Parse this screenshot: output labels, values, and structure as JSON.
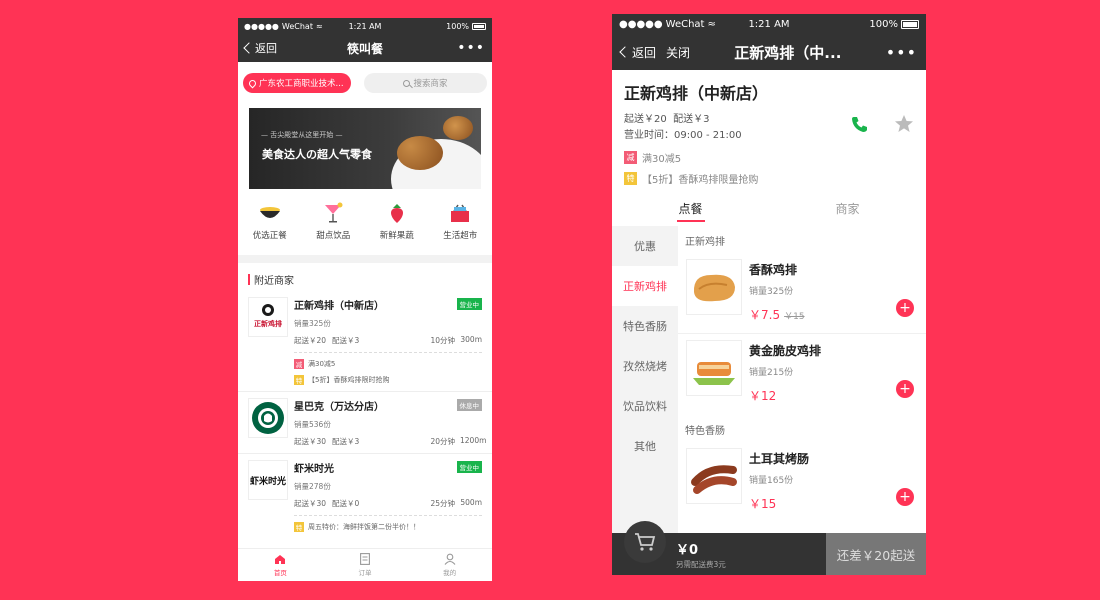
{
  "phoneA": {
    "status": {
      "carrier": "WeChat",
      "time": "1:21 AM",
      "battery": "100%"
    },
    "nav": {
      "back": "返回",
      "title": "筷叫餐",
      "more": "•••"
    },
    "location": "广东农工商职业技术...",
    "search_placeholder": "搜索商家",
    "banner": {
      "subtitle": "— 舌尖殿堂从这里开始 —",
      "title": "美食达人の超人气零食"
    },
    "categories": [
      {
        "label": "优选正餐",
        "icon": "bowl-icon"
      },
      {
        "label": "甜点饮品",
        "icon": "cocktail-icon"
      },
      {
        "label": "新鲜果蔬",
        "icon": "strawberry-icon"
      },
      {
        "label": "生活超市",
        "icon": "basket-icon"
      }
    ],
    "section_title": "附近商家",
    "shops": [
      {
        "name": "正新鸡排（中新店）",
        "sales": "销量325份",
        "min": "起送￥20",
        "delivery": "配送￥3",
        "time": "10分钟",
        "distance": "300m",
        "status": "营业中",
        "promos": [
          {
            "tag": "减",
            "text": "满30减5"
          },
          {
            "tag": "特",
            "text": "【5折】香酥鸡排限时抢购"
          }
        ]
      },
      {
        "name": "星巴克（万达分店）",
        "sales": "销量536份",
        "min": "起送￥30",
        "delivery": "配送￥3",
        "time": "20分钟",
        "distance": "1200m",
        "status": "休息中",
        "promos": []
      },
      {
        "name": "虾米时光",
        "sales": "销量278份",
        "min": "起送￥30",
        "delivery": "配送￥0",
        "time": "25分钟",
        "distance": "500m",
        "status": "营业中",
        "promos": [
          {
            "tag": "特",
            "text": "周五特价：海鲜拌饭第二份半价！！"
          }
        ]
      }
    ],
    "tabs": [
      "首页",
      "订单",
      "我的"
    ],
    "logo_text": {
      "zhengxin": "正新鸡排",
      "xiami": "虾米时光"
    }
  },
  "phoneB": {
    "status": {
      "carrier": "WeChat",
      "time": "1:21 AM",
      "battery": "100%"
    },
    "nav": {
      "back": "返回",
      "close": "关闭",
      "title": "正新鸡排（中...",
      "more": "•••"
    },
    "store": {
      "name": "正新鸡排（中新店）",
      "min": "起送￥20",
      "delivery": "配送￥3",
      "hours": "营业时间：09:00 - 21:00"
    },
    "promos": [
      {
        "tag": "减",
        "text": "满30减5"
      },
      {
        "tag": "特",
        "text": "【5折】香酥鸡排限量抢购"
      }
    ],
    "tabs": [
      "点餐",
      "商家"
    ],
    "left_menu": [
      "优惠",
      "正新鸡排",
      "特色香肠",
      "孜然烧烤",
      "饮品饮料",
      "其他"
    ],
    "groups": [
      {
        "title": "正新鸡排",
        "items": [
          {
            "name": "香酥鸡排",
            "sales": "销量325份",
            "price": "￥7.5",
            "old_price": "￥15"
          },
          {
            "name": "黄金脆皮鸡排",
            "sales": "销量215份",
            "price": "￥12",
            "old_price": ""
          }
        ]
      },
      {
        "title": "特色香肠",
        "items": [
          {
            "name": "土耳其烤肠",
            "sales": "销量165份",
            "price": "￥15",
            "old_price": ""
          }
        ]
      }
    ],
    "cart": {
      "total": "￥0",
      "sub": "另需配送费3元",
      "checkout": "还差￥20起送"
    }
  },
  "colors": {
    "brand": "#ff3355",
    "dark": "#333333",
    "open": "#19b44c"
  }
}
